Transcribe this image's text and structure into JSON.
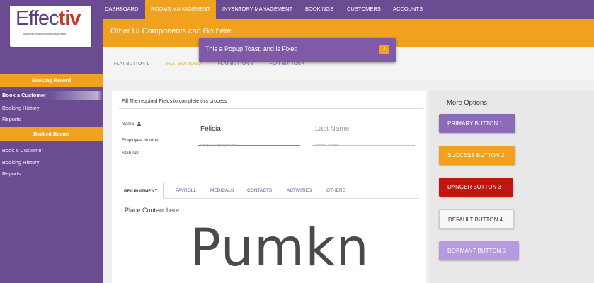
{
  "logo": {
    "main": "Effec",
    "accent": "tiv",
    "subtitle": "Business and Accounting Manager"
  },
  "topnav": {
    "items": [
      "DASHBOARD",
      "ROOMS MANAGEMENT",
      "INVENTORY MANAGEMENT",
      "BOOKINGS",
      "CUSTOMERS",
      "ACCOUNTS"
    ],
    "active": "ROOMS MANAGEMENT"
  },
  "banner": {
    "text": "Other UI Components can Go here"
  },
  "toast": {
    "text": "This a Popup Toast, and is Fixed",
    "close_label": "x"
  },
  "flat_buttons": [
    "FLAT BUTTON 1",
    "FLAT BUTTON 2",
    "FLAT BUTTON 3",
    "FLAT BUTTON 4"
  ],
  "sidebar": {
    "section1": {
      "title": "Booking Record",
      "items": [
        "Book a Customer",
        "Booking History",
        "Reports"
      ],
      "active": "Book a Customer"
    },
    "section2": {
      "title": "Booked Rooms",
      "items": [
        "Book a Customer",
        "Booking History",
        "Reports"
      ]
    }
  },
  "form": {
    "title": "Fill The required Fields to complete this process",
    "name_label": "Name",
    "first_name_value": "Felicia",
    "last_name_placeholder": "Last Name",
    "employee_label": "Employee Number",
    "employee_placeholder": "Unique Employee No",
    "middle_placeholder": "Middle Name",
    "statuses_label": "Statuses"
  },
  "tabs": {
    "items": [
      "RECRUITMENT",
      "PAYROLL",
      "MEDICALS",
      "CONTACTS",
      "ACTIVITIES",
      "OTHERS"
    ],
    "active": "RECRUITMENT"
  },
  "content": {
    "placeholder": "Place Content here",
    "big_text": "Pumkn"
  },
  "options": {
    "title": "More Options",
    "buttons": [
      "PRIMARY BUTTON 1",
      "SUCCESS BUTTON 2",
      "DANGER BUTTON 3",
      "DEFAULT BUTTON 4",
      "DORMANT BUTTON 5"
    ]
  },
  "colors": {
    "primary": "#6b4c93",
    "accent": "#f0a11d",
    "danger": "#c0160f",
    "dormant": "#b59ae0"
  }
}
